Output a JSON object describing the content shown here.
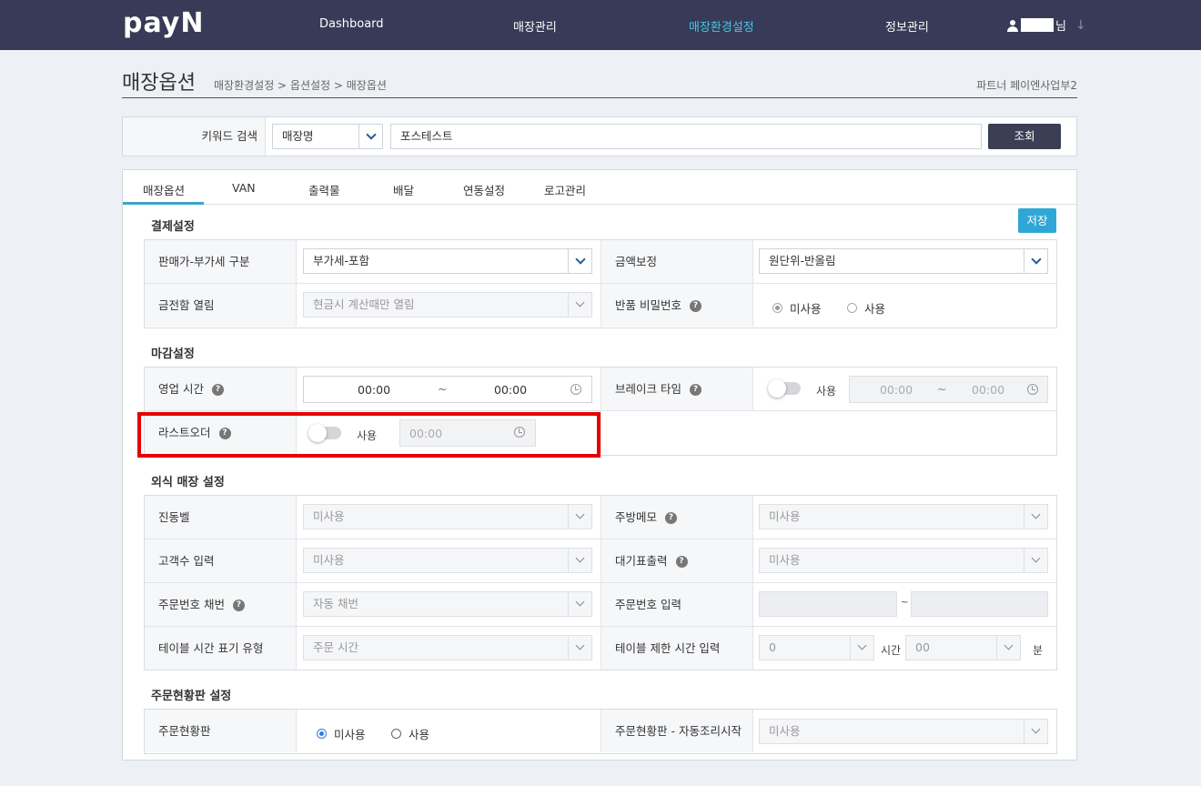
{
  "nav": {
    "logo": "payN",
    "items": [
      "Dashboard",
      "매장관리",
      "매장환경설정",
      "정보관리"
    ],
    "active_index": 2,
    "user_suffix": "님"
  },
  "page": {
    "title": "매장옵션",
    "breadcrumb": "매장환경설정 > 옵션설정 > 매장옵션",
    "partner": "파트너 페이엔사업부2"
  },
  "search": {
    "label": "키워드 검색",
    "type": "매장명",
    "keyword": "포스테스트",
    "button": "조회"
  },
  "tabs": [
    "매장옵션",
    "VAN",
    "출력물",
    "배달",
    "연동설정",
    "로고관리"
  ],
  "save": "저장",
  "sections": {
    "payment": {
      "title": "결제설정",
      "vat_label": "판매가-부가세 구분",
      "vat_value": "부가세-포함",
      "amount_label": "금액보정",
      "amount_value": "원단위-반올림",
      "drawer_label": "금전함 열림",
      "drawer_value": "현금시 계산때만 열림",
      "refund_label": "반품 비밀번호",
      "refund_opt1": "미사용",
      "refund_opt2": "사용"
    },
    "closing": {
      "title": "마감설정",
      "hours_label": "영업 시간",
      "hours_start": "00:00",
      "hours_sep": "~",
      "hours_end": "00:00",
      "break_label": "브레이크 타임",
      "break_toggle": "사용",
      "break_start": "00:00",
      "break_sep": "~",
      "break_end": "00:00",
      "lastorder_label": "라스트오더",
      "lastorder_toggle": "사용",
      "lastorder_time": "00:00"
    },
    "dining": {
      "title": "외식 매장 설정",
      "bell_label": "진동벨",
      "bell_value": "미사용",
      "kitchen_label": "주방메모",
      "kitchen_value": "미사용",
      "guests_label": "고객수 입력",
      "guests_value": "미사용",
      "wait_label": "대기표출력",
      "wait_value": "미사용",
      "ordno_label": "주문번호 채번",
      "ordno_value": "자동 채번",
      "ordinput_label": "주문번호 입력",
      "ordinput_sep": "~",
      "tabletime_label": "테이블 시간 표기 유형",
      "tabletime_value": "주문 시간",
      "tablelimit_label": "테이블 제한 시간 입력",
      "tablelimit_hours": "0",
      "tablelimit_hours_unit": "시간",
      "tablelimit_mins": "00",
      "tablelimit_mins_unit": "분"
    },
    "board": {
      "title": "주문현황판 설정",
      "board_label": "주문현황판",
      "board_opt1": "미사용",
      "board_opt2": "사용",
      "auto_label": "주문현황판 - 자동조리시작",
      "auto_value": "미사용"
    }
  }
}
